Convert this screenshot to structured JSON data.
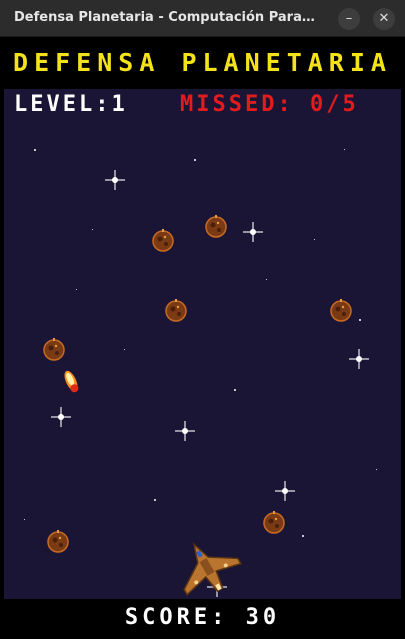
{
  "window": {
    "title": "Defensa Planetaria - Computación Paral...",
    "minimize_label": "–",
    "close_label": "✕"
  },
  "game": {
    "title": "DEFENSA PLANETARIA",
    "level_text": "LEVEL:1",
    "missed_text": "MISSED: 0/5",
    "score_text": "SCORE: 30",
    "level": 1,
    "missed": 0,
    "missed_max": 5,
    "score": 30
  },
  "icons": {
    "asteroid": "asteroid-icon",
    "ship": "spaceship-icon",
    "missile": "missile-icon"
  },
  "colors": {
    "title": "#f4e21a",
    "missed": "#e21c1c",
    "background": "#1b1535"
  }
}
